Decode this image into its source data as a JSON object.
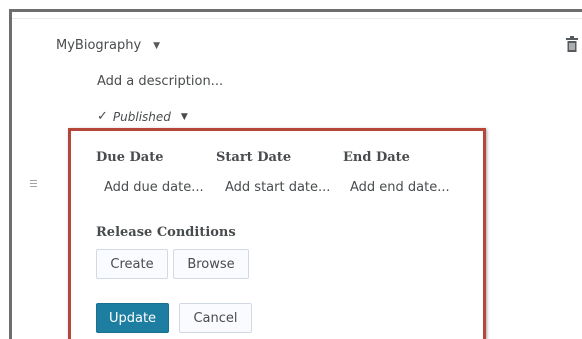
{
  "module": {
    "title": "MyBiography",
    "description_placeholder": "Add a description...",
    "status": "Published"
  },
  "dates": {
    "headers": [
      "Due Date",
      "Start Date",
      "End Date"
    ],
    "links": [
      "Add due date...",
      "Add start date...",
      "Add end date..."
    ]
  },
  "release_conditions": {
    "label": "Release Conditions",
    "create_label": "Create",
    "browse_label": "Browse"
  },
  "actions": {
    "update_label": "Update",
    "cancel_label": "Cancel"
  },
  "icons": {
    "title_caret": "chevron-down-icon",
    "status_caret": "chevron-down-icon",
    "check": "check-icon",
    "trash": "trash-icon",
    "drag": "drag-handle-icon"
  },
  "colors": {
    "highlight_border": "#b5473a",
    "primary_button": "#1e7ea1"
  }
}
